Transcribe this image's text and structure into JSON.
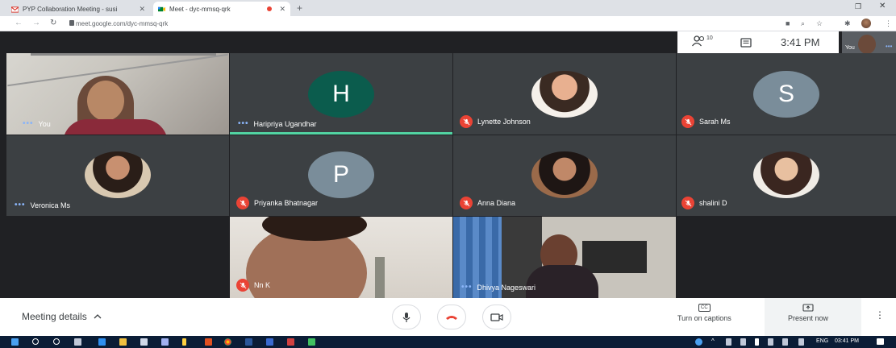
{
  "browser": {
    "tabs": [
      {
        "title": "PYP Collaboration Meeting - susi",
        "icon": "gmail-icon",
        "active": false
      },
      {
        "title": "Meet - dyc-mmsq-qrk",
        "icon": "meet-icon",
        "active": true
      }
    ],
    "url": "meet.google.com/dyc-mmsq-qrk",
    "new_tab": "+",
    "minimize": "❐",
    "close": "✕"
  },
  "meet": {
    "participant_count": "10",
    "time": "3:41 PM",
    "self_label": "You",
    "tiles": [
      {
        "name": "You",
        "indicator": "dots",
        "type": "video"
      },
      {
        "name": "Haripriya Ugandhar",
        "indicator": "dots",
        "type": "letter",
        "letter": "H",
        "color": "#0b5c4d",
        "speaking": true
      },
      {
        "name": "Lynette Johnson",
        "indicator": "muted",
        "type": "photo"
      },
      {
        "name": "Sarah Ms",
        "indicator": "muted",
        "type": "letter",
        "letter": "S",
        "color": "#7a8d9a"
      },
      {
        "name": "Veronica Ms",
        "indicator": "dots",
        "type": "photo"
      },
      {
        "name": "Priyanka Bhatnagar",
        "indicator": "muted",
        "type": "letter",
        "letter": "P",
        "color": "#7a8d9a"
      },
      {
        "name": "Anna Diana",
        "indicator": "muted",
        "type": "photo"
      },
      {
        "name": "shalini D",
        "indicator": "muted",
        "type": "photo"
      },
      {
        "name": "Nn K",
        "indicator": "muted",
        "type": "video"
      },
      {
        "name": "Dhivya Nageswari",
        "indicator": "dots",
        "type": "video"
      }
    ]
  },
  "bottom": {
    "meeting_details": "Meeting details",
    "captions_label": "Turn on captions",
    "captions_icon": "CC",
    "present_label": "Present now"
  },
  "taskbar": {
    "lang": "ENG",
    "clock": "03:41 PM"
  }
}
